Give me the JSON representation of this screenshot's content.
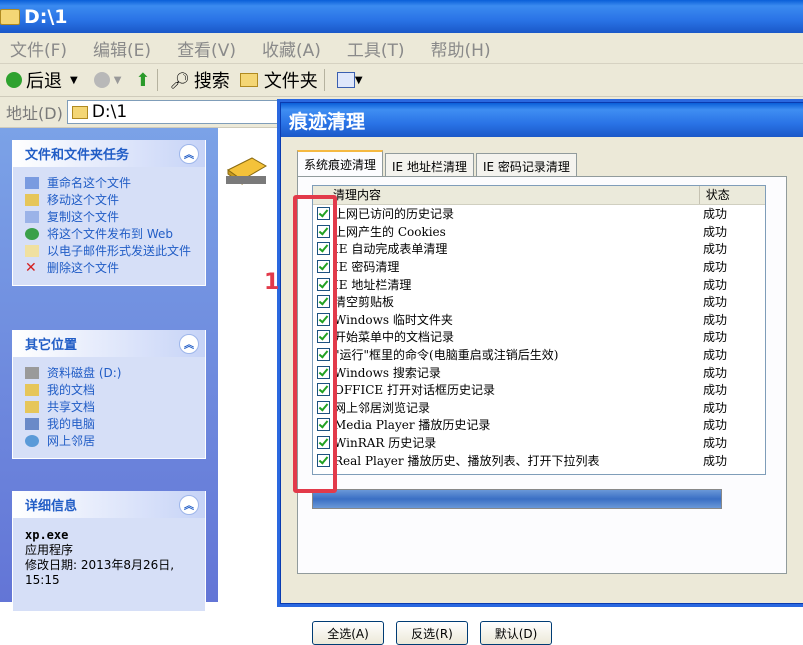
{
  "explorer": {
    "title": "D:\\1",
    "menu": [
      "文件(F)",
      "编辑(E)",
      "查看(V)",
      "收藏(A)",
      "工具(T)",
      "帮助(H)"
    ],
    "toolbar": {
      "back": "后退",
      "search": "搜索",
      "folders": "文件夹"
    },
    "address": {
      "label": "地址(D)",
      "value": "D:\\1"
    }
  },
  "taskpane": {
    "file_tasks": {
      "title": "文件和文件夹任务",
      "items": [
        "重命名这个文件",
        "移动这个文件",
        "复制这个文件",
        "将这个文件发布到 Web",
        "以电子邮件形式发送此文件",
        "删除这个文件"
      ]
    },
    "other_places": {
      "title": "其它位置",
      "items": [
        "资料磁盘 (D:)",
        "我的文档",
        "共享文档",
        "我的电脑",
        "网上邻居"
      ]
    },
    "details": {
      "title": "详细信息",
      "filename": "xp.exe",
      "type": "应用程序",
      "modified": "修改日期: 2013年8月26日, 15:15"
    }
  },
  "dialog": {
    "title": "痕迹清理",
    "tabs": [
      "系统痕迹清理",
      "IE 地址栏清理",
      "IE 密码记录清理"
    ],
    "columns": {
      "name": "清理内容",
      "status": "状态"
    },
    "rows": [
      {
        "name": "上网已访问的历史记录",
        "status": "成功"
      },
      {
        "name": "上网产生的 Cookies",
        "status": "成功"
      },
      {
        "name": "IE 自动完成表单清理",
        "status": "成功"
      },
      {
        "name": "IE 密码清理",
        "status": "成功"
      },
      {
        "name": "IE 地址栏清理",
        "status": "成功"
      },
      {
        "name": "清空剪贴板",
        "status": "成功"
      },
      {
        "name": "Windows 临时文件夹",
        "status": "成功"
      },
      {
        "name": "开始菜单中的文档记录",
        "status": "成功"
      },
      {
        "name": "\"运行\"框里的命令(电脑重启或注销后生效)",
        "status": "成功"
      },
      {
        "name": "Windows 搜索记录",
        "status": "成功"
      },
      {
        "name": "OFFICE 打开对话框历史记录",
        "status": "成功"
      },
      {
        "name": "网上邻居浏览记录",
        "status": "成功"
      },
      {
        "name": "Media Player 播放历史记录",
        "status": "成功"
      },
      {
        "name": "WinRAR 历史记录",
        "status": "成功"
      },
      {
        "name": "Real Player 播放历史、播放列表、打开下拉列表",
        "status": "成功"
      }
    ],
    "progress_fraction": 1.0,
    "buttons": {
      "select_all": "全选(A)",
      "invert": "反选(R)",
      "default": "默认(D)"
    }
  },
  "annotation": {
    "label": "1",
    "color": "#e23a4a"
  }
}
